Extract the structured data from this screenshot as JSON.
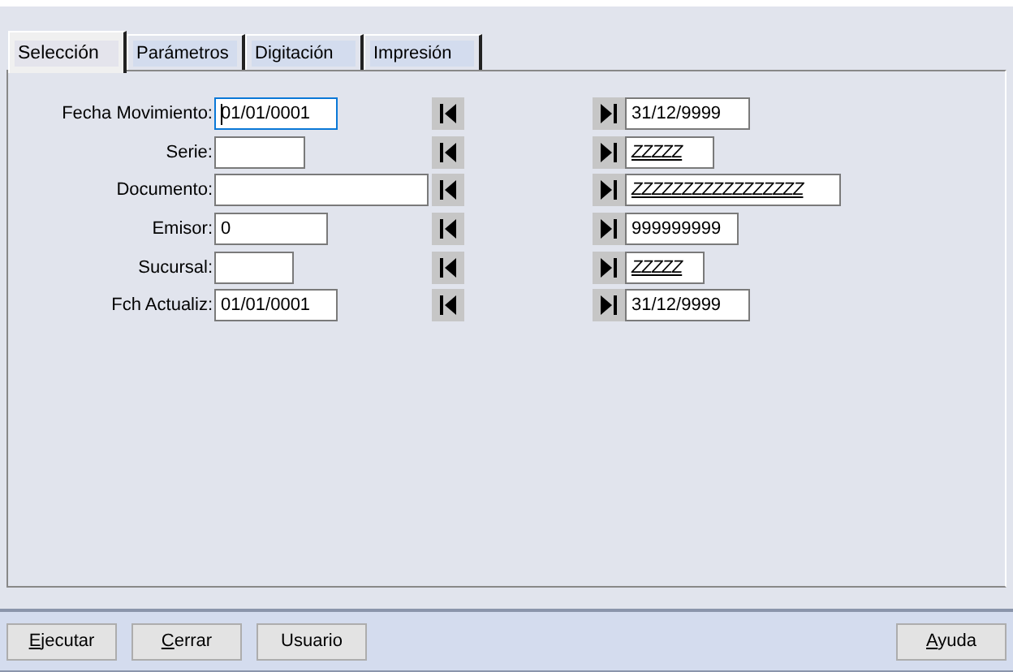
{
  "tabs": [
    {
      "label": "Selección",
      "selected": true
    },
    {
      "label": "Parámetros",
      "selected": false
    },
    {
      "label": "Digitación",
      "selected": false
    },
    {
      "label": "Impresión",
      "selected": false
    }
  ],
  "rows": [
    {
      "label": "Fecha Movimiento:",
      "from": {
        "value": "01/01/0001",
        "kind": "text",
        "focused": true
      },
      "to": {
        "value": "31/12/9999",
        "kind": "text",
        "focused": false
      }
    },
    {
      "label": "Serie:",
      "from": {
        "focused": false
      },
      "to": {
        "value": "ZZZZZ",
        "kind": "mask",
        "focused": false
      }
    },
    {
      "label": "Documento:",
      "from": {
        "focused": false
      },
      "to": {
        "value": "ZZZZZZZZZZZZZZZZZ",
        "kind": "mask",
        "focused": false
      }
    },
    {
      "label": "Emisor:",
      "from": {
        "value": "0",
        "kind": "text",
        "focused": false
      },
      "to": {
        "value": "999999999",
        "kind": "text",
        "focused": false
      }
    },
    {
      "label": "Sucursal:",
      "from": {
        "focused": false
      },
      "to": {
        "value": "ZZZZZ",
        "kind": "mask",
        "focused": false
      }
    },
    {
      "label": "Fch Actualiz:",
      "from": {
        "value": "01/01/0001",
        "kind": "text",
        "focused": false
      },
      "to": {
        "value": "31/12/9999",
        "kind": "text",
        "focused": false
      }
    }
  ],
  "buttons_left": [
    {
      "label": "Ejecutar",
      "access_key": true
    },
    {
      "label": "Cerrar",
      "access_key": true
    },
    {
      "label": "Usuario",
      "access_key": false
    }
  ],
  "buttons_right": [
    {
      "label": "Ayuda",
      "access_key": true
    }
  ]
}
